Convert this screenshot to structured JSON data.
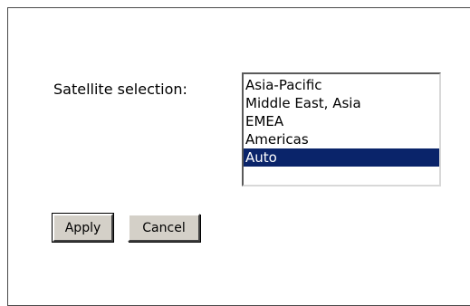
{
  "form": {
    "satellite_label": "Satellite selection:",
    "satellite_options": [
      {
        "label": "Asia-Pacific",
        "selected": false
      },
      {
        "label": "Middle East, Asia",
        "selected": false
      },
      {
        "label": "EMEA",
        "selected": false
      },
      {
        "label": "Americas",
        "selected": false
      },
      {
        "label": "Auto",
        "selected": true
      }
    ],
    "selected_value": "Auto",
    "apply_label": "Apply",
    "cancel_label": "Cancel"
  },
  "colors": {
    "selection_background": "#0a246a",
    "button_face": "#d4d0c8"
  }
}
